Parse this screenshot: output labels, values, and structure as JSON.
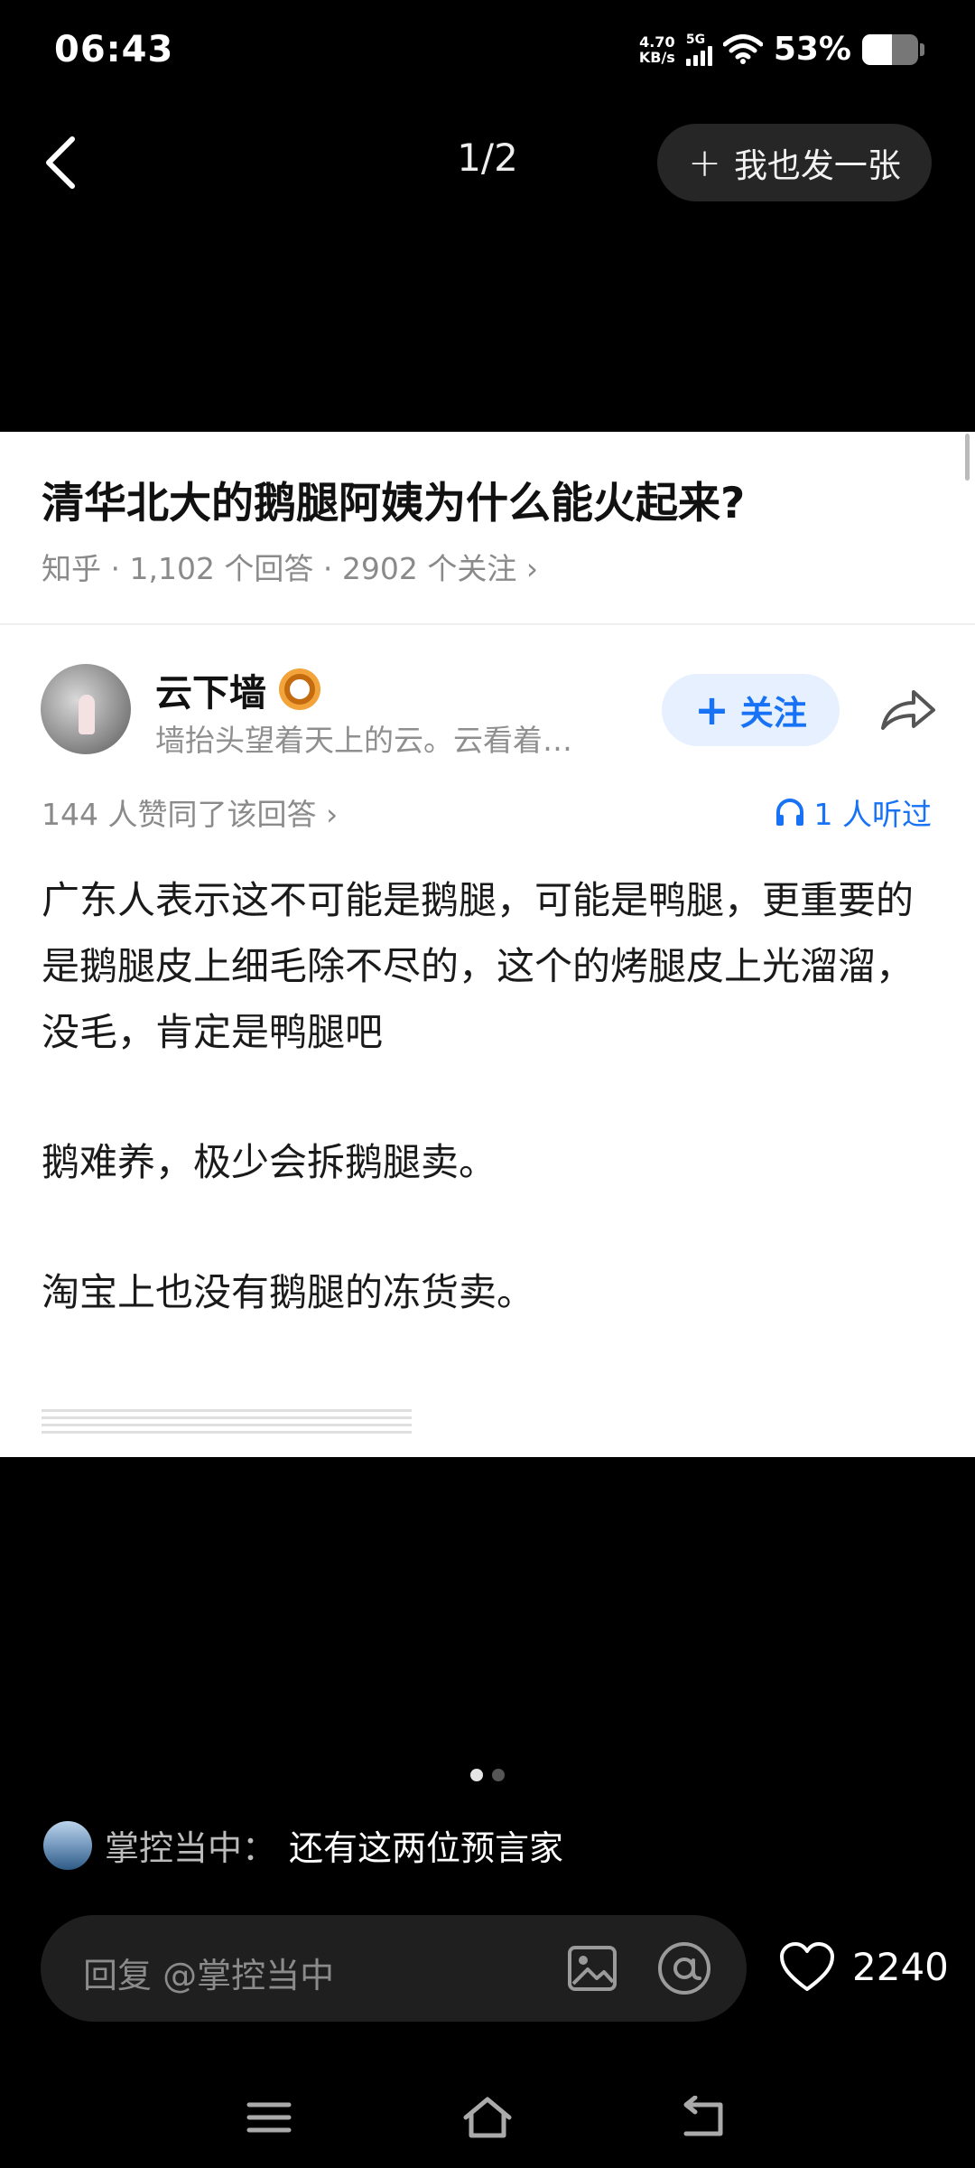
{
  "status_bar": {
    "time": "06:43",
    "net_speed_value": "4.70",
    "net_speed_unit": "KB/s",
    "network": "5G",
    "battery_percent": "53%",
    "icons": [
      "signal-bars-icon",
      "wifi-icon",
      "battery-icon"
    ]
  },
  "top_nav": {
    "pager": "1/2",
    "post_button": "我也发一张"
  },
  "card": {
    "question_title": "清华北大的鹅腿阿姨为什么能火起来?",
    "question_meta": "知乎 · 1,102 个回答 · 2902 个关注 ›",
    "author_name": "云下墙",
    "author_bio": "墙抬头望着天上的云。云看着…",
    "follow_label": "关注",
    "likes_line": "144 人赞同了该回答 ›",
    "listened": "1 人听过",
    "answer_paragraphs": [
      "广东人表示这不可能是鹅腿，可能是鸭腿，更重要的是鹅腿皮上细毛除不尽的，这个的烤腿皮上光溜溜，没毛，肯定是鸭腿吧",
      "鹅难养，极少会拆鹅腿卖。",
      "淘宝上也没有鹅腿的冻货卖。"
    ],
    "accent_color": "#1772f6"
  },
  "pager_dots": {
    "total": 2,
    "active": 1
  },
  "comment": {
    "user": "掌控当中：",
    "text": "还有这两位预言家"
  },
  "reply_bar": {
    "placeholder": "回复 @掌控当中",
    "like_count": "2240"
  }
}
